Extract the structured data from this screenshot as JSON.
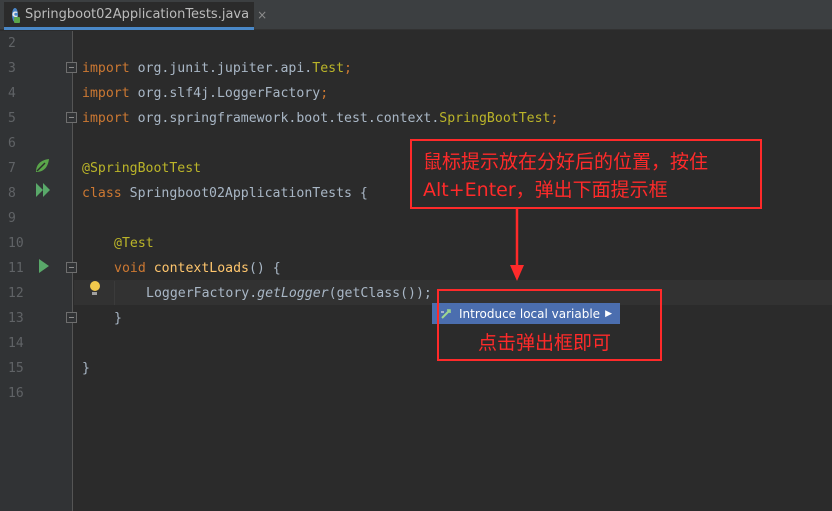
{
  "tab": {
    "file_name": "Springboot02ApplicationTests.java",
    "close_glyph": "×",
    "icon_letter": "c"
  },
  "line_numbers": [
    "2",
    "3",
    "4",
    "5",
    "6",
    "7",
    "8",
    "9",
    "10",
    "11",
    "12",
    "13",
    "14",
    "15",
    "16"
  ],
  "code": {
    "l3_kw": "import",
    "l3_pkg": " org.junit.jupiter.api.",
    "l3_cls": "Test",
    "l3_end": ";",
    "l4_kw": "import",
    "l4_pkg": " org.slf4j.LoggerFactory",
    "l4_end": ";",
    "l5_kw": "import",
    "l5_pkg": " org.springframework.boot.test.context.",
    "l5_cls": "SpringBootTest",
    "l5_end": ";",
    "l7_ann": "@SpringBootTest",
    "l8_kw": "class",
    "l8_rest": " Springboot02ApplicationTests {",
    "l10_ann": "@Test",
    "l11_kw": "void",
    "l11_fn": " contextLoads",
    "l11_rest": "() {",
    "l12_a": "LoggerFactory.",
    "l12_b": "getLogger",
    "l12_c": "(getClass());",
    "l13": "}",
    "l15": "}"
  },
  "intention_popup": {
    "label": "Introduce local variable",
    "arrow": "▶"
  },
  "annotations": {
    "top_line1": "鼠标提示放在分好后的位置，按住",
    "top_line2": "Alt+Enter，弹出下面提示框",
    "bottom": "点击弹出框即可",
    "color": "#ff2a2a"
  }
}
